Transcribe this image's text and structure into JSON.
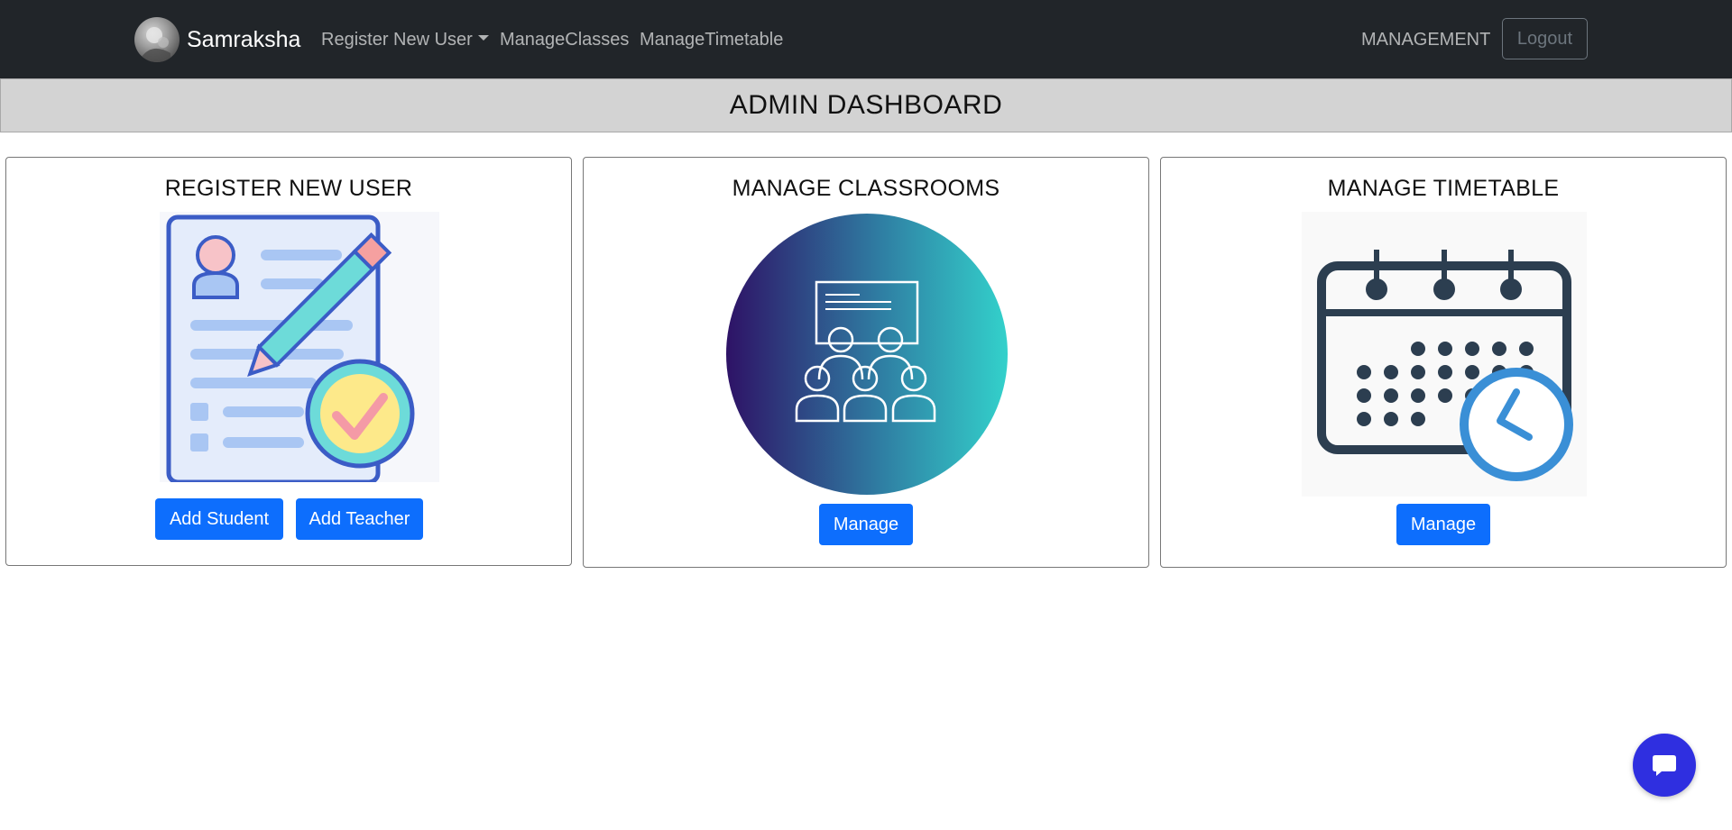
{
  "navbar": {
    "brand": "Samraksha",
    "links": {
      "register": "Register New User",
      "classes": "ManageClasses",
      "timetable": "ManageTimetable"
    },
    "role": "MANAGEMENT",
    "logout": "Logout"
  },
  "page": {
    "title": "ADMIN DASHBOARD"
  },
  "cards": {
    "register": {
      "title": "REGISTER NEW USER",
      "buttons": {
        "add_student": "Add Student",
        "add_teacher": "Add Teacher"
      }
    },
    "classrooms": {
      "title": "MANAGE CLASSROOMS",
      "button": "Manage"
    },
    "timetable": {
      "title": "MANAGE TIMETABLE",
      "button": "Manage"
    }
  },
  "colors": {
    "navbar_bg": "#212529",
    "primary": "#0d6efd",
    "title_bar_bg": "#d3d3d3",
    "chat_button": "#2f2fe0"
  },
  "icons": {
    "brand_logo": "avatar-logo",
    "dropdown": "caret-down-icon",
    "chat": "chat-bubble-icon"
  }
}
